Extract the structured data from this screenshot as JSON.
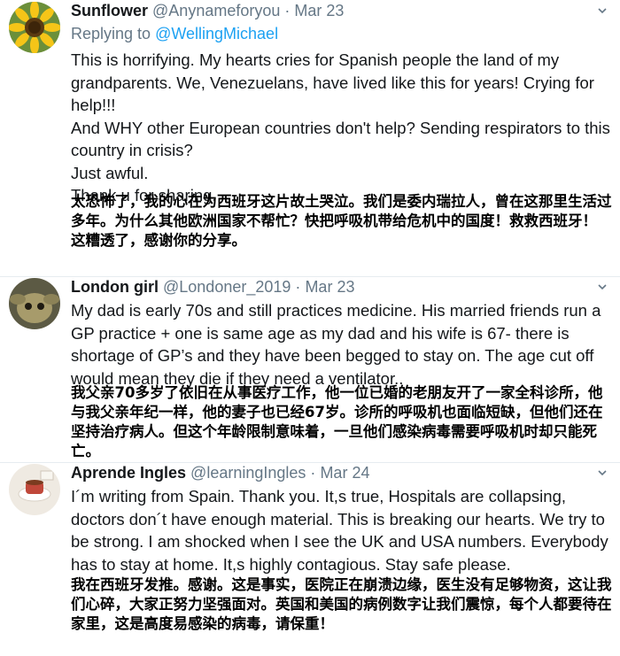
{
  "tweets": [
    {
      "name": "Sunflower",
      "handle": "@Anynameforyou",
      "dot": "·",
      "date": "Mar 23",
      "replying_prefix": "Replying to",
      "replying_to": "@WellingMichael",
      "text_lines": [
        "This is horrifying. My hearts cries for Spanish people the land of my grandparents. We, Venezuelans, have lived like this for years! Crying for help!!!",
        "And WHY other European countries don't help? Sending respirators to this country in crisis?",
        "Just awful.",
        "Thank u for sharing."
      ],
      "translation_lines": [
        "太恐怖了，我的心在为西班牙这片故土哭泣。我们是委内瑞拉人，曾在这那里生活过多年。为什么其他欧洲国家不帮忙？快把呼吸机带给危机中的国度！救救西班牙！",
        "这糟透了，感谢你的分享。"
      ]
    },
    {
      "name": "London girl",
      "handle": "@Londoner_2019",
      "dot": "·",
      "date": "Mar 23",
      "text_lines": [
        "My dad is early 70s and still practices medicine. His married friends run a GP practice + one is same age as my dad and his wife is 67- there is shortage of GP’s and they have been begged to stay on. The age cut off would mean they die if they need a ventilator.."
      ],
      "translation_lines": [
        "我父亲70多岁了依旧在从事医疗工作，他一位已婚的老朋友开了一家全科诊所，他与我父亲年纪一样，他的妻子也已经67岁。诊所的呼吸机也面临短缺，但他们还在坚持治疗病人。但这个年龄限制意味着，一旦他们感染病毒需要呼吸机时却只能死亡。"
      ]
    },
    {
      "name": "Aprende Ingles",
      "handle": "@learningIngles",
      "dot": "·",
      "date": "Mar 24",
      "text_lines": [
        "I´m writing from Spain. Thank you. It,s true, Hospitals are collapsing, doctors don´t have enough material. This is breaking our hearts. We try to be strong. I am shocked when I see the UK and USA numbers. Everybody has to stay at home. It,s highly contagious. Stay safe please."
      ],
      "translation_lines": [
        "我在西班牙发推。感谢。这是事实，医院正在崩溃边缘，医生没有足够物资，这让我们心碎，大家正努力坚强面对。英国和美国的病例数字让我们震惊，每个人都要待在家里，这是高度易感染的病毒，请保重！"
      ]
    }
  ],
  "icons": {
    "menu": "chevron-down-icon"
  },
  "colors": {
    "link": "#1da1f2",
    "muted": "#657786",
    "text": "#14171a"
  }
}
